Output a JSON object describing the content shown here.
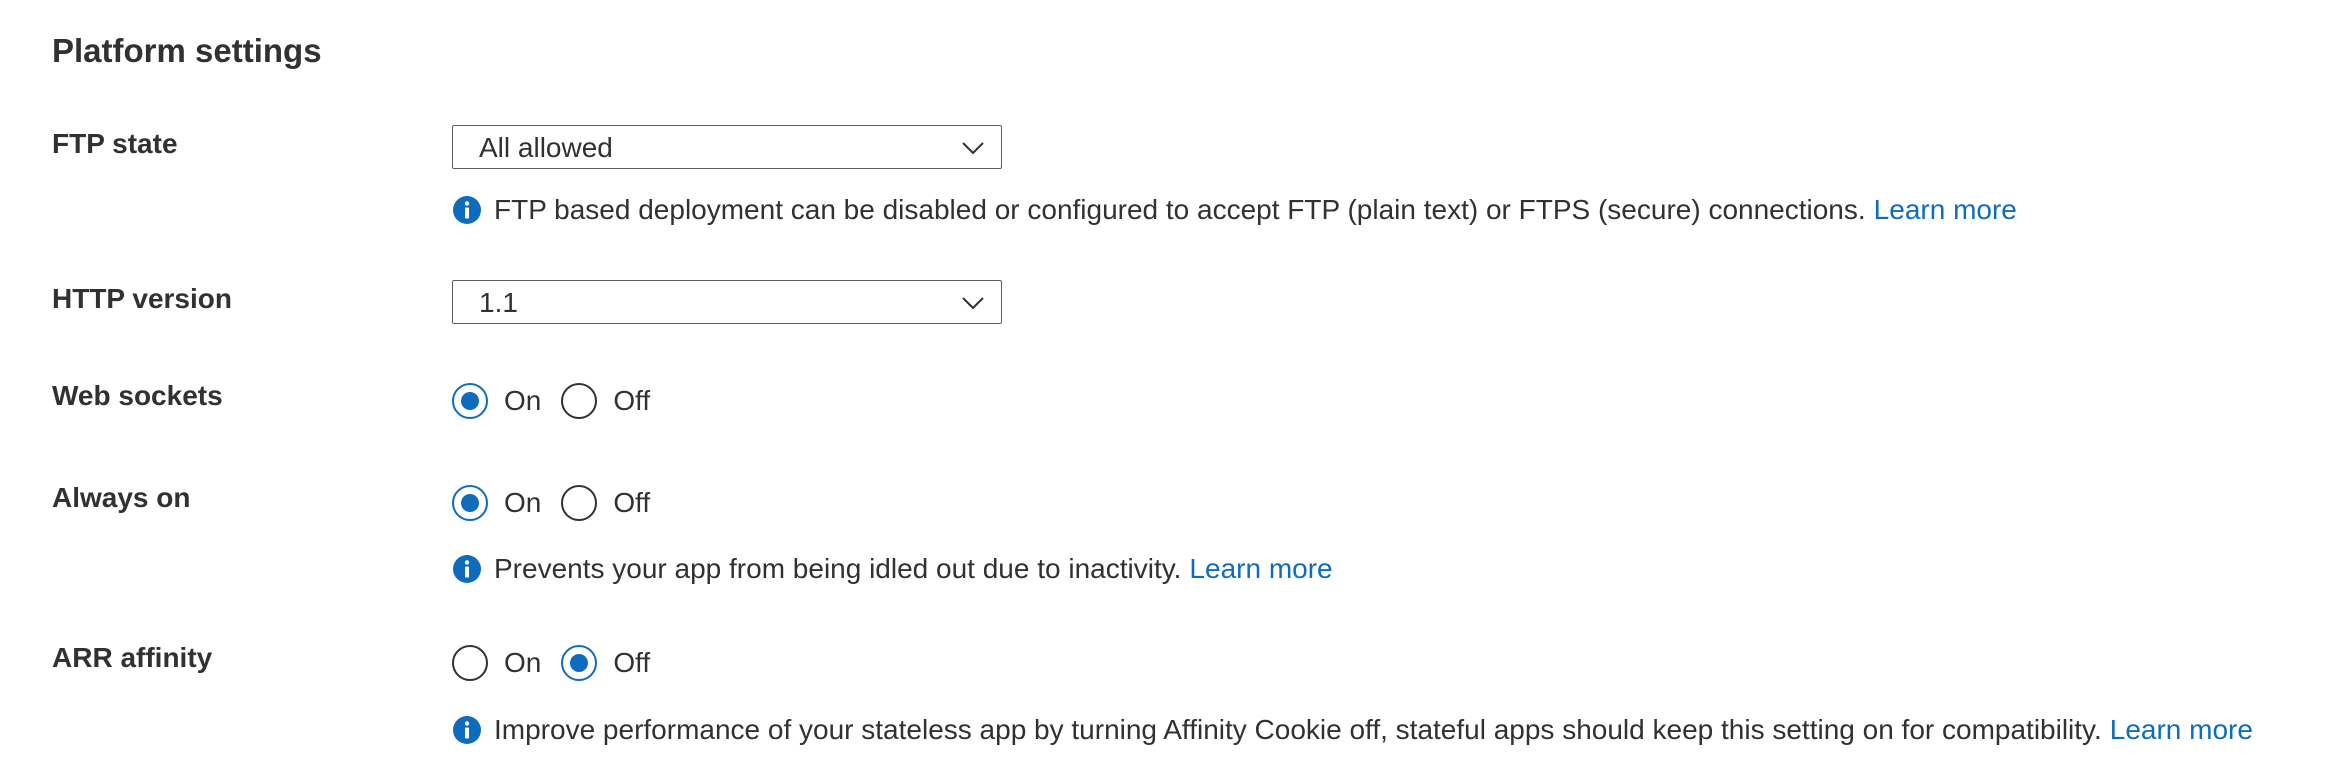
{
  "section": {
    "title": "Platform settings"
  },
  "ftp_state": {
    "label": "FTP state",
    "selected": "All allowed",
    "info": "FTP based deployment can be disabled or configured to accept FTP (plain text) or FTPS (secure) connections.",
    "link": "Learn more"
  },
  "http_version": {
    "label": "HTTP version",
    "selected": "1.1"
  },
  "web_sockets": {
    "label": "Web sockets",
    "on_label": "On",
    "off_label": "Off",
    "value": "On"
  },
  "always_on": {
    "label": "Always on",
    "on_label": "On",
    "off_label": "Off",
    "value": "On",
    "info": "Prevents your app from being idled out due to inactivity.",
    "link": "Learn more"
  },
  "arr_affinity": {
    "label": "ARR affinity",
    "on_label": "On",
    "off_label": "Off",
    "value": "Off",
    "info": "Improve performance of your stateless app by turning Affinity Cookie off, stateful apps should keep this setting on for compatibility.",
    "link": "Learn more"
  },
  "colors": {
    "accent": "#0f6cbd",
    "text": "#323130",
    "border": "#605e5c"
  },
  "icons": {
    "info": "info-icon",
    "chevron": "chevron-down-icon"
  }
}
